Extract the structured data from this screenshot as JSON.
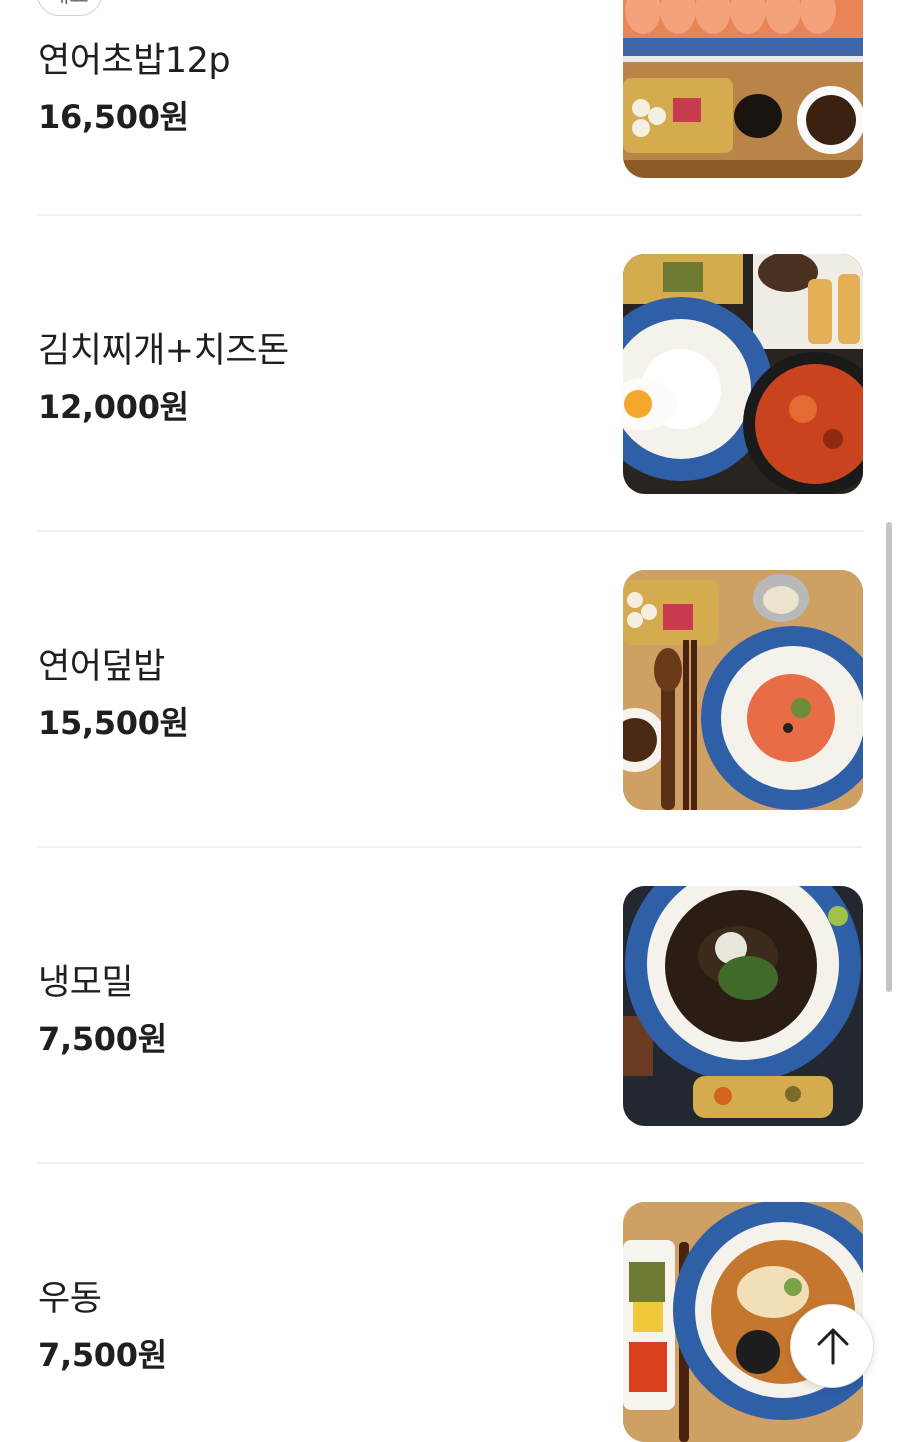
{
  "menu": {
    "items": [
      {
        "badge": "대표",
        "name": "연어초밥12p",
        "price": "16,500원",
        "image": "salmon-sushi-photo"
      },
      {
        "name": "김치찌개+치즈돈",
        "price": "12,000원",
        "image": "kimchi-stew-cheese-cutlet-photo"
      },
      {
        "name": "연어덮밥",
        "price": "15,500원",
        "image": "salmon-rice-bowl-photo"
      },
      {
        "name": "냉모밀",
        "price": "7,500원",
        "image": "cold-buckwheat-noodle-photo"
      },
      {
        "name": "우동",
        "price": "7,500원",
        "image": "udon-photo"
      }
    ]
  },
  "scroll_top_button": {
    "icon": "arrow-up-icon"
  },
  "colors": {
    "text": "#1f1f1f",
    "divider": "#f1f1f1",
    "scrollbar": "#c4c4c4",
    "badge_border": "#cfcfcf"
  }
}
